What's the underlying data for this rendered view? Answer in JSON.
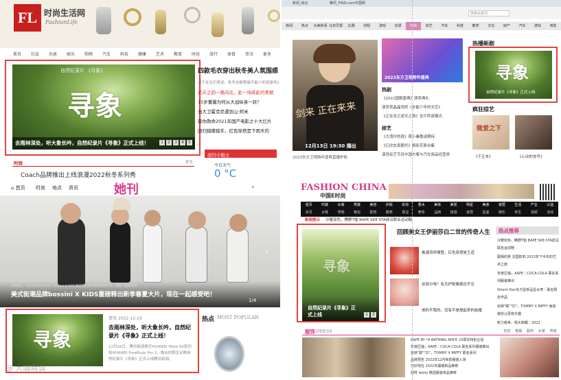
{
  "q1": {
    "logo_mark": "FL",
    "logo_cn": "时尚生活网",
    "logo_en": "FashionLife",
    "nav": [
      "首页",
      "社会",
      "乐居",
      "娱乐",
      "购物",
      "汽车",
      "科技",
      "健康",
      "艺术",
      "教育",
      "时尚",
      "旅行",
      "体育",
      "资讯",
      "更多"
    ],
    "headline": "四款毛衣穿出秋冬美人氛围感",
    "sub_headline": "对于女生们来说，秋冬衣橱里最不能少的就是毛衣了",
    "news": [
      "花卉之韵一路向北，赴一场奔赴的美丽",
      "15岁董馨为何从大战纵身一跃？",
      "当大卫霍克尼遇到山·阿米",
      "奔你救命2021年国产电影之十大烂片",
      "回归猎蝶猎手，红色穿搭是下雨天的"
    ],
    "banner_top": "自然纪录片 《寻象》",
    "banner_calli": "寻象",
    "banner_caption": "去雨林深处，听大象长吟，自然纪录片《寻象》正式上线！",
    "pager": [
      "1",
      "2",
      "3",
      "4",
      "5"
    ],
    "section_label": "时尚",
    "section_more": "更多",
    "bottom_left": "Coach品牌推出上线浪漫2022秋冬系列秀",
    "side_label": "出行小贴士",
    "weather_label": "今日天气",
    "weather_value": "0 °C"
  },
  "q2": {
    "tabs": [
      "新闻_综合",
      "腾讯_FIND.com中国网"
    ],
    "search_placeholder": "搜索关键词",
    "nav": [
      "新闻",
      "热点",
      "北美新闻",
      "北京早报",
      "比赛",
      "财经",
      "游戏",
      "动漫",
      "时尚",
      "综艺",
      "汽车",
      "科技",
      "教育",
      "文化",
      "房产",
      "汽车",
      "游戏",
      "电影"
    ],
    "star_caption": "12月13日 19:30 播出",
    "star_calli": "剑来 正在来来",
    "show_caption": "2023东方卫视跨年盛典",
    "hot_title": "热剧",
    "hot_items": [
      "《2022国剧盛典》颁奖典礼",
      "演员贾晶晶领奖《全能少年的天空》",
      "《正在念之逆天之旅》全片阵容曝光"
    ],
    "variety_title": "综艺",
    "variety_items": [
      "《大湾仔的夜》首小秦敬请期待",
      "《亿欣女真朝代》精彩花絮合集",
      "演员综艺节目中国方案与汽车商品经营类"
    ],
    "left_cap": "2023东方卫视跨年盛典直播护航",
    "right_title": "热播新剧",
    "right_caption": "自然纪录片《寻象》正式上线",
    "crazy_title": "疯狂综艺",
    "crazy_items": [
      "《于正本》",
      "《心动的信号》"
    ],
    "right_calli": "寻象",
    "crazy_badge": "微爱之下"
  },
  "q3": {
    "nav": [
      "首页",
      "时尚",
      "地点",
      "资讯"
    ],
    "logo": "她刊",
    "hero_caption": "美式街潮品牌bossini X KIDS重磅释出新季春夏大片，现在一起感受吧！",
    "hero_sub": "8月某日，2022年12月13日，bossini X KIDS重磅释出新季春夏系列大片，现在一起感受吧！",
    "hero_pager": "1/4",
    "date": "2022-12-29",
    "date_prefix": "资讯",
    "article_title": "去雨林深处，听大象长吟，自然纪录片《寻象》正式上线！",
    "article_desc": "12月26日，腾讯新闻携手HUAWEI Mate 50系列和HUAWEI FreeBuds Pro 2，推出的野生动物自然纪录片《寻象》正式上线腾讯新闻。",
    "hot_cn": "热点",
    "hot_en": "MOST POPULAR",
    "thumb_calli": "寻象",
    "watermark": "@ 大咖商谈"
  },
  "q4": {
    "logo_en": "FASHION CHINA",
    "logo_cn": "中国E时尚",
    "nav_top": [
      "首页",
      "时装",
      "女装",
      "男装",
      "美容",
      "护肤",
      "彩妆",
      "香水",
      "美体",
      "美发",
      "明星",
      "美食",
      "家居",
      "生活",
      "产业",
      "公益"
    ],
    "nav_bottom": [
      "资讯",
      "女鞋",
      "男鞋",
      "箱包",
      "配饰",
      "腕表",
      "珠宝",
      "奢侈",
      "品牌",
      "旅游",
      "家居",
      "星座",
      "娱乐",
      "养生",
      "视频",
      "活动"
    ],
    "ticker_label": "新闻提示",
    "ticker": "冷暖双色，腾野T恤 BAPE SK8 STA前沿联名运动鞋",
    "headline": "回顾美女王伊丽莎白二世的传奇人生",
    "items": [
      "看潮流呼啸登，红色穿搭是王道",
      "这部分电？有无护肤素面还不见",
      "他的不我的，没有不是想起来的结婚"
    ],
    "feature_caption": "自然纪录片《寻象》正式上线",
    "hot_title": "热点推荐",
    "hot_items": [
      "冷暖双色，腾野T恤 BAPE SK8 STA前沿联名运动鞋",
      "跟相的男 法国影响 2022年下半年的艺术之旅",
      "年度压轴，AAPE｜COCA-COLA 联名系列服装推出",
      "Orient Star东方星新品星水表｜联名限定作品",
      "玩转\"联\"\"扛\"，TOMMY X MIFFY 兔娃装扮让更有乐趣",
      "新力趋世，街头制霸｜2022"
    ],
    "section": "服饰",
    "section_en": "DRESS",
    "section_tabs": [
      "包包",
      "鞋履",
      "服饰",
      "女装",
      "男装"
    ],
    "list": [
      "AAPE BY *A BATHING APE® 10周年特别企划",
      "年度压轴，AAPE｜COCA-COLA 联名系列服装推出",
      "玩转\"联\"\"扛\"，TOMMY X MIFFY 联名系列",
      "品牌预告 2022年12月新款服装入场",
      "巧妙地在 2022年服装新品推荐",
      "别样 lexity 精选服装单品推荐"
    ],
    "feature_calli": "寻象",
    "pager": [
      "1",
      "2"
    ]
  }
}
